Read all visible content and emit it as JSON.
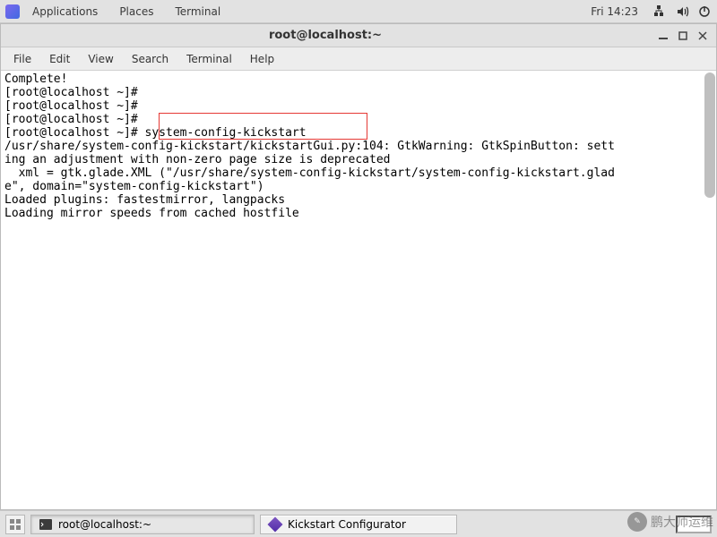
{
  "panel": {
    "applications": "Applications",
    "places": "Places",
    "terminal": "Terminal",
    "clock": "Fri 14:23"
  },
  "window": {
    "title": "root@localhost:~"
  },
  "menubar": {
    "file": "File",
    "edit": "Edit",
    "view": "View",
    "search": "Search",
    "terminal": "Terminal",
    "help": "Help"
  },
  "terminal": {
    "lines": [
      "Complete!",
      "[root@localhost ~]#",
      "[root@localhost ~]#",
      "[root@localhost ~]#",
      "[root@localhost ~]# system-config-kickstart",
      "/usr/share/system-config-kickstart/kickstartGui.py:104: GtkWarning: GtkSpinButton: sett",
      "ing an adjustment with non-zero page size is deprecated",
      "  xml = gtk.glade.XML (\"/usr/share/system-config-kickstart/system-config-kickstart.glad",
      "e\", domain=\"system-config-kickstart\")",
      "Loaded plugins: fastestmirror, langpacks",
      "Loading mirror speeds from cached hostfile"
    ],
    "highlighted_command": "system-config-kickstart"
  },
  "taskbar": {
    "task1": "root@localhost:~",
    "task2": "Kickstart Configurator"
  },
  "watermark": {
    "text": "鹏大师运维"
  }
}
